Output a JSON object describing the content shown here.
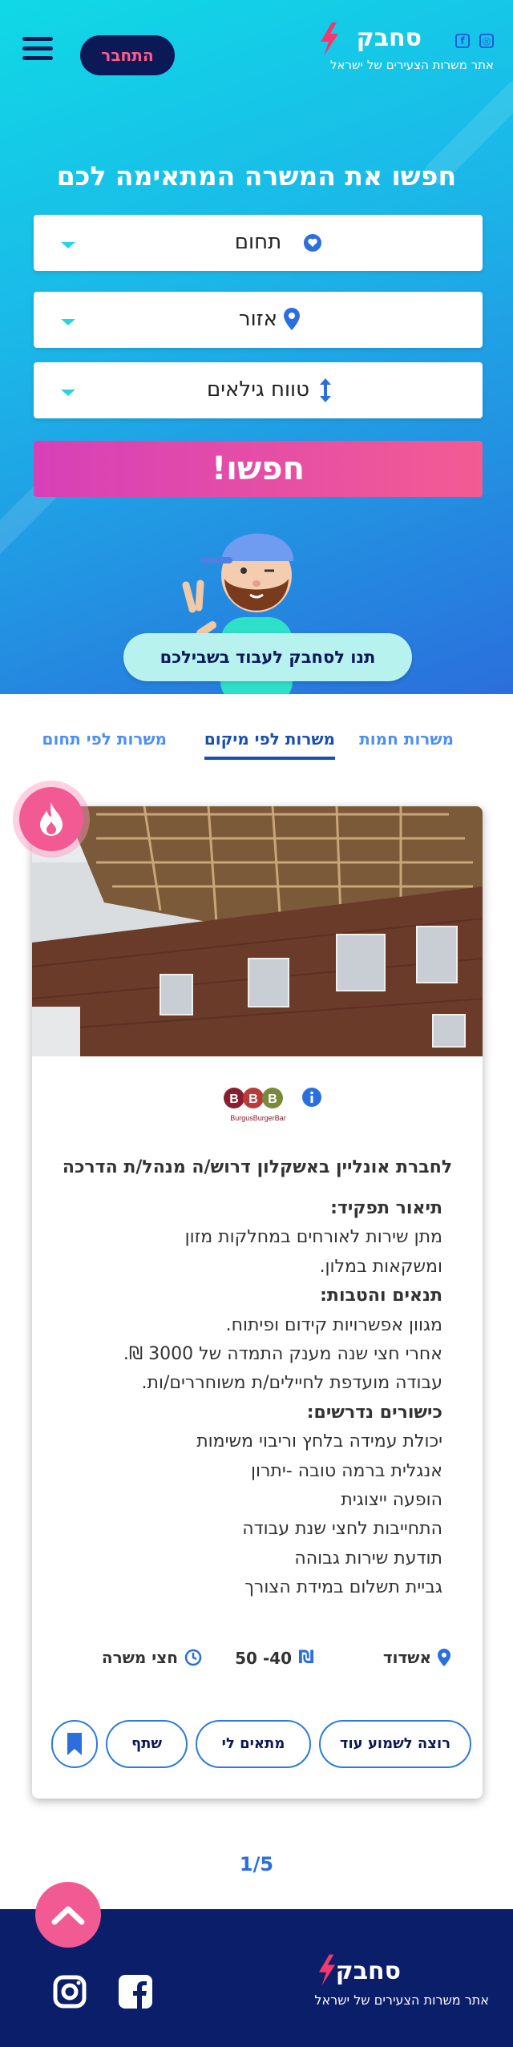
{
  "header": {
    "login_label": "התחבר",
    "brand": "סחבק",
    "tagline": "אתר משרות הצעירים של ישראל",
    "social_icons": [
      "facebook-icon",
      "instagram-icon"
    ]
  },
  "hero": {
    "title": "חפשו את המשרה המתאימה לכם",
    "field_select": "תחום",
    "area_select": "אזור",
    "age_select": "טווח גילאים",
    "search_label": "חפשו!",
    "cta_label": "תנו לסחבק לעבוד בשבילכם"
  },
  "tabs": [
    {
      "label": "משרות חמות",
      "active": false
    },
    {
      "label": "משרות לפי מיקום",
      "active": true
    },
    {
      "label": "משרות לפי תחום",
      "active": false
    }
  ],
  "job": {
    "company_logo_text": "BurgusBurgerBar",
    "title": "לחברת אונליין באשקלון דרוש/ה מנהל/ת הדרכה",
    "description": [
      {
        "text": "תיאור תפקיד:",
        "heading": true
      },
      {
        "text": "מתן שירות לאורחים במחלקות מזון",
        "heading": false
      },
      {
        "text": "ומשקאות במלון.",
        "heading": false
      },
      {
        "text": "תנאים והטבות:",
        "heading": true
      },
      {
        "text": "מגוון אפשרויות קידום ופיתוח.",
        "heading": false
      },
      {
        "text": "אחרי חצי שנה מענק התמדה של 3000 ₪.",
        "heading": false
      },
      {
        "text": "עבודה מועדפת לחיילים/ת משוחררים/ות.",
        "heading": false
      },
      {
        "text": "כישורים נדרשים:",
        "heading": true
      },
      {
        "text": "יכולת עמידה בלחץ וריבוי משימות",
        "heading": false
      },
      {
        "text": "אנגלית ברמה טובה -יתרון",
        "heading": false
      },
      {
        "text": "הופעה ייצוגית",
        "heading": false
      },
      {
        "text": "התחייבות לחצי שנת עבודה",
        "heading": false
      },
      {
        "text": "תודעת שירות גבוהה",
        "heading": false
      },
      {
        "text": "גביית תשלום במידת הצורך",
        "heading": false
      }
    ],
    "location": "אשדוד",
    "salary": "40- 50",
    "job_type": "חצי משרה",
    "buttons": {
      "more_info": "רוצה לשמוע עוד",
      "suits_me": "מתאים לי",
      "share": "שתף"
    }
  },
  "pager": "1/5",
  "colors": {
    "accent_pink": "#f25a93",
    "navy": "#0b1a57",
    "blue": "#2a6fdc",
    "cyan": "#10d9e6"
  }
}
